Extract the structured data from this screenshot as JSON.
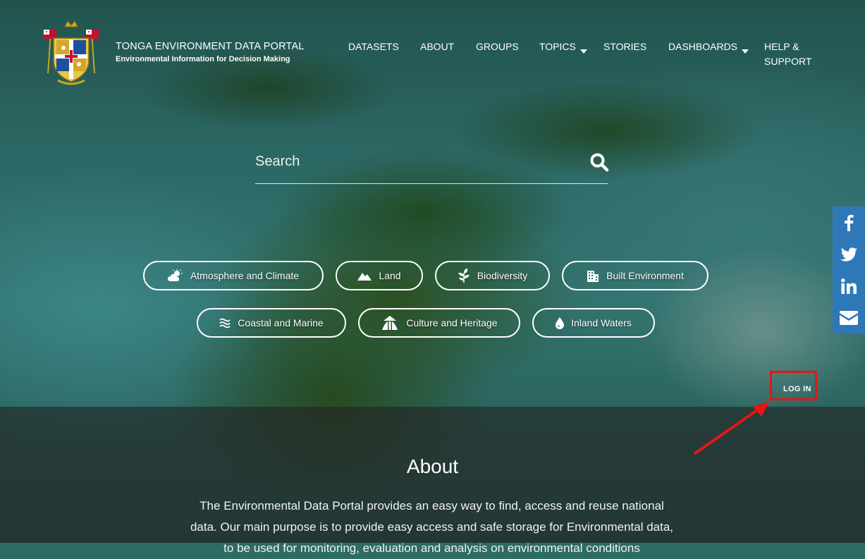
{
  "header": {
    "title": "TONGA ENVIRONMENT DATA PORTAL",
    "subtitle": "Environmental Information for Decision Making"
  },
  "nav": {
    "items": [
      {
        "label": "DATASETS",
        "dropdown": false
      },
      {
        "label": "ABOUT",
        "dropdown": false
      },
      {
        "label": "GROUPS",
        "dropdown": false
      },
      {
        "label": "TOPICS",
        "dropdown": true
      },
      {
        "label": "STORIES",
        "dropdown": false
      },
      {
        "label": "DASHBOARDS",
        "dropdown": true
      },
      {
        "label_line1": "HELP &",
        "label_line2": "SUPPORT",
        "dropdown": false
      }
    ]
  },
  "search": {
    "placeholder": "Search",
    "icon": "search-icon"
  },
  "topics": [
    {
      "label": "Atmosphere and Climate",
      "icon": "cloud-sun-icon"
    },
    {
      "label": "Land",
      "icon": "mountain-icon"
    },
    {
      "label": "Biodiversity",
      "icon": "leaf-icon"
    },
    {
      "label": "Built Environment",
      "icon": "building-icon"
    },
    {
      "label": "Coastal and Marine",
      "icon": "waves-icon"
    },
    {
      "label": "Culture and Heritage",
      "icon": "culture-icon"
    },
    {
      "label": "Inland Waters",
      "icon": "water-drop-icon"
    }
  ],
  "social": [
    "facebook-icon",
    "twitter-icon",
    "linkedin-icon",
    "envelope-icon"
  ],
  "login": {
    "label": "LOG IN",
    "highlight_color": "#e51616"
  },
  "about": {
    "title": "About",
    "text": "The Environmental Data Portal provides an easy way to find, access and reuse national data. Our main purpose is to provide easy access and safe storage for Environmental data, to be used for monitoring, evaluation and analysis on environmental conditions"
  },
  "colors": {
    "social_bar": "#2f78b7",
    "text": "#ffffff"
  }
}
